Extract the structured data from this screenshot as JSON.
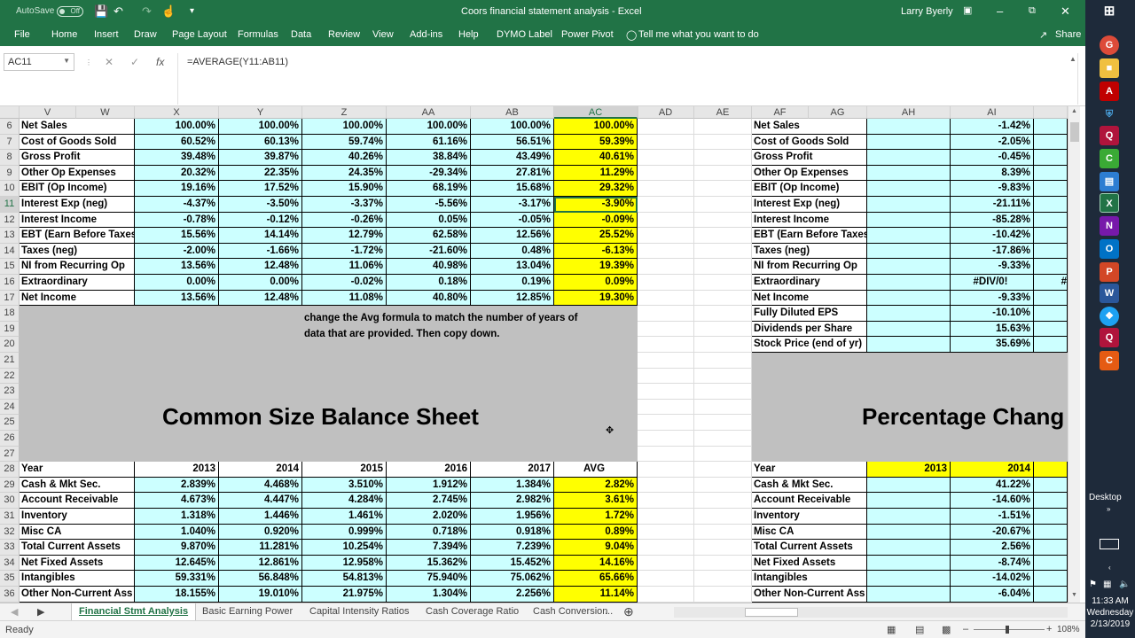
{
  "window": {
    "title": "Coors financial statement analysis  -  Excel",
    "user": "Larry Byerly",
    "autosave_label": "AutoSave",
    "autosave_state": "Off"
  },
  "ribbon": {
    "tabs": [
      "File",
      "Home",
      "Insert",
      "Draw",
      "Page Layout",
      "Formulas",
      "Data",
      "Review",
      "View",
      "Add-ins",
      "Help",
      "DYMO Label",
      "Power Pivot"
    ],
    "tell_me": "Tell me what you want to do",
    "share": "Share"
  },
  "formula_bar": {
    "name_box": "AC11",
    "formula": "=AVERAGE(Y11:AB11)"
  },
  "grid": {
    "col_headers_left": [
      "V",
      "W",
      "X",
      "Y",
      "Z",
      "AA",
      "AB",
      "AC",
      "AD",
      "AE"
    ],
    "col_headers_right": [
      "AF",
      "AG",
      "AH",
      "AI"
    ],
    "row_numbers": [
      "6",
      "7",
      "8",
      "9",
      "10",
      "11",
      "12",
      "13",
      "14",
      "15",
      "16",
      "17",
      "18",
      "19",
      "20",
      "21",
      "22",
      "23",
      "24",
      "25",
      "26",
      "27",
      "28",
      "29",
      "30",
      "31",
      "32",
      "33",
      "34",
      "35",
      "36"
    ],
    "income": {
      "labels": [
        "Net Sales",
        "Cost of Goods Sold",
        "Gross Profit",
        "Other Op Expenses",
        "EBIT (Op Income)",
        "Interest Exp (neg)",
        "Interest Income",
        "EBT (Earn Before Taxes",
        "Taxes (neg)",
        "NI from Recurring Op",
        "Extraordinary",
        "Net Income"
      ],
      "rows": [
        [
          "100.00%",
          "100.00%",
          "100.00%",
          "100.00%",
          "100.00%",
          "100.00%"
        ],
        [
          "60.52%",
          "60.13%",
          "59.74%",
          "61.16%",
          "56.51%",
          "59.39%"
        ],
        [
          "39.48%",
          "39.87%",
          "40.26%",
          "38.84%",
          "43.49%",
          "40.61%"
        ],
        [
          "20.32%",
          "22.35%",
          "24.35%",
          "-29.34%",
          "27.81%",
          "11.29%"
        ],
        [
          "19.16%",
          "17.52%",
          "15.90%",
          "68.19%",
          "15.68%",
          "29.32%"
        ],
        [
          "-4.37%",
          "-3.50%",
          "-3.37%",
          "-5.56%",
          "-3.17%",
          "-3.90%"
        ],
        [
          "-0.78%",
          "-0.12%",
          "-0.26%",
          "0.05%",
          "-0.05%",
          "-0.09%"
        ],
        [
          "15.56%",
          "14.14%",
          "12.79%",
          "62.58%",
          "12.56%",
          "25.52%"
        ],
        [
          "-2.00%",
          "-1.66%",
          "-1.72%",
          "-21.60%",
          "0.48%",
          "-6.13%"
        ],
        [
          "13.56%",
          "12.48%",
          "11.06%",
          "40.98%",
          "13.04%",
          "19.39%"
        ],
        [
          "0.00%",
          "0.00%",
          "-0.02%",
          "0.18%",
          "0.19%",
          "0.09%"
        ],
        [
          "13.56%",
          "12.48%",
          "11.08%",
          "40.80%",
          "12.85%",
          "19.30%"
        ]
      ]
    },
    "note_line1": "change the Avg formula to match the number of years of",
    "note_line2": "data that are provided. Then copy down.",
    "balance_title": "Common Size Balance Sheet",
    "balance": {
      "header": [
        "Year",
        "2013",
        "2014",
        "2015",
        "2016",
        "2017",
        "AVG"
      ],
      "labels": [
        "Cash & Mkt Sec.",
        "Account Receivable",
        "Inventory",
        "Misc CA",
        "Total Current Assets",
        "Net Fixed Assets",
        "Intangibles",
        "Other Non-Current Ass"
      ],
      "rows": [
        [
          "2.839%",
          "4.468%",
          "3.510%",
          "1.912%",
          "1.384%",
          "2.82%"
        ],
        [
          "4.673%",
          "4.447%",
          "4.284%",
          "2.745%",
          "2.982%",
          "3.61%"
        ],
        [
          "1.318%",
          "1.446%",
          "1.461%",
          "2.020%",
          "1.956%",
          "1.72%"
        ],
        [
          "1.040%",
          "0.920%",
          "0.999%",
          "0.718%",
          "0.918%",
          "0.89%"
        ],
        [
          "9.870%",
          "11.281%",
          "10.254%",
          "7.394%",
          "7.239%",
          "9.04%"
        ],
        [
          "12.645%",
          "12.861%",
          "12.958%",
          "15.362%",
          "15.452%",
          "14.16%"
        ],
        [
          "59.331%",
          "56.848%",
          "54.813%",
          "75.940%",
          "75.062%",
          "65.66%"
        ],
        [
          "18.155%",
          "19.010%",
          "21.975%",
          "1.304%",
          "2.256%",
          "11.14%"
        ]
      ]
    },
    "pct_change": {
      "labels": [
        "Net Sales",
        "Cost of Goods Sold",
        "Gross Profit",
        "Other Op Expenses",
        "EBIT (Op Income)",
        "Interest Exp (neg)",
        "Interest Income",
        "EBT (Earn Before Taxes",
        "Taxes (neg)",
        "NI from Recurring Op",
        "Extraordinary",
        "Net Income",
        "Fully Diluted EPS",
        "Dividends per Share",
        "Stock Price (end of yr)"
      ],
      "values": [
        "-1.42%",
        "-2.05%",
        "-0.45%",
        "8.39%",
        "-9.83%",
        "-21.11%",
        "-85.28%",
        "-10.42%",
        "-17.86%",
        "-9.33%",
        "#DIV/0!",
        "-9.33%",
        "-10.10%",
        "15.63%",
        "35.69%"
      ],
      "extra_aj16": "#",
      "title": "Percentage Chang",
      "header": [
        "Year",
        "2013",
        "2014"
      ],
      "bs_labels": [
        "Cash & Mkt Sec.",
        "Account Receivable",
        "Inventory",
        "Misc CA",
        "Total Current Assets",
        "Net Fixed Assets",
        "Intangibles",
        "Other Non-Current Ass"
      ],
      "bs_values": [
        "41.22%",
        "-14.60%",
        "-1.51%",
        "-20.67%",
        "2.56%",
        "-8.74%",
        "-14.02%",
        "-6.04%"
      ]
    }
  },
  "sheet_tabs": [
    "Financial Stmt Analysis",
    "Basic Earning Power",
    "Capital Intensity Ratios",
    "Cash Coverage Ratio",
    "Cash Conversion"
  ],
  "more_tabs": "...",
  "status": {
    "ready": "Ready",
    "zoom": "108%"
  },
  "taskbar": {
    "desktop_label": "Desktop",
    "time": "11:33 AM",
    "day": "Wednesday",
    "date": "2/13/2019"
  },
  "colors": {
    "excel_green": "#217346",
    "cyan_fill": "#ccffff",
    "yellow_fill": "#ffff00",
    "gray_fill": "#c0c0c0"
  }
}
